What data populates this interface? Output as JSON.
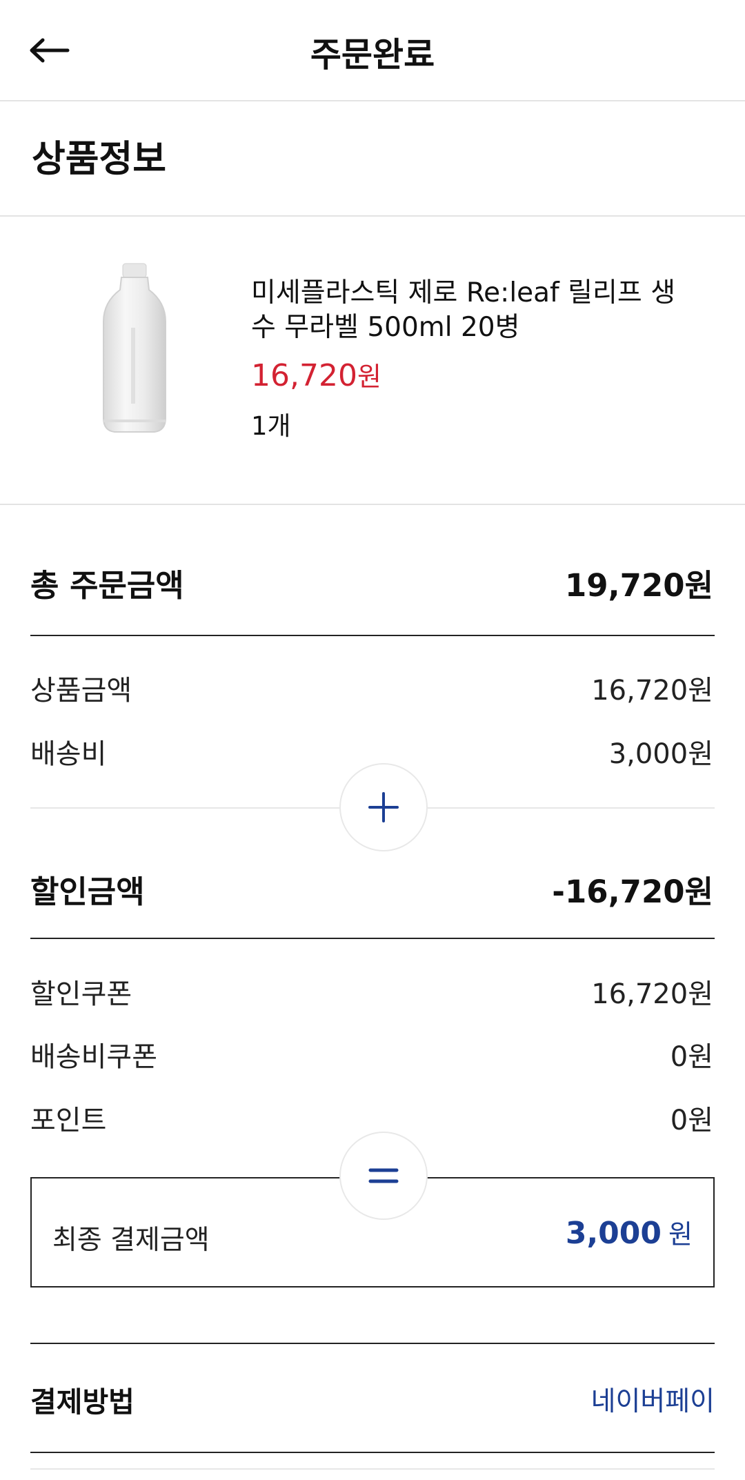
{
  "header": {
    "title": "주문완료",
    "back_icon": "arrow-left-icon"
  },
  "product_section": {
    "title": "상품정보",
    "product": {
      "name": "미세플라스틱 제로 Re:leaf 릴리프 생수 무라벨 500ml 20병",
      "price": "16,720",
      "price_unit": "원",
      "quantity": "1개",
      "price_color": "#d32232"
    }
  },
  "summary": {
    "total_order": {
      "label": "총 주문금액",
      "value": "19,720원"
    },
    "product_amount": {
      "label": "상품금액",
      "value": "16,720원"
    },
    "shipping": {
      "label": "배송비",
      "value": "3,000원"
    },
    "discount_total": {
      "label": "할인금액",
      "value": "-16,720원"
    },
    "discount_coupon": {
      "label": "할인쿠폰",
      "value": "16,720원"
    },
    "shipping_coupon": {
      "label": "배송비쿠폰",
      "value": "0원"
    },
    "points": {
      "label": "포인트",
      "value": "0원"
    },
    "plus_icon": "plus-icon",
    "equals_icon": "equals-icon"
  },
  "final_payment": {
    "label": "최종 결제금액",
    "amount": "3,000",
    "unit": "원",
    "accent_color": "#1c3f94"
  },
  "payment_method": {
    "label": "결제방법",
    "value": "네이버페이"
  }
}
